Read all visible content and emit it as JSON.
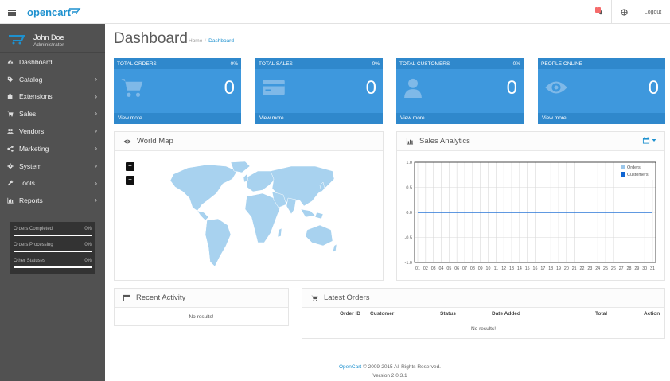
{
  "header": {
    "logo_text": "opencart",
    "notification_count": "1",
    "logout_label": "Logout"
  },
  "sidebar": {
    "profile": {
      "name": "John Doe",
      "role": "Administrator"
    },
    "items": [
      {
        "label": "Dashboard",
        "icon": "dashboard-icon",
        "has_children": false
      },
      {
        "label": "Catalog",
        "icon": "tag-icon",
        "has_children": true
      },
      {
        "label": "Extensions",
        "icon": "puzzle-icon",
        "has_children": true
      },
      {
        "label": "Sales",
        "icon": "cart-icon",
        "has_children": true
      },
      {
        "label": "Vendors",
        "icon": "users-icon",
        "has_children": true
      },
      {
        "label": "Marketing",
        "icon": "share-icon",
        "has_children": true
      },
      {
        "label": "System",
        "icon": "cog-icon",
        "has_children": true
      },
      {
        "label": "Tools",
        "icon": "wrench-icon",
        "has_children": true
      },
      {
        "label": "Reports",
        "icon": "bar-chart-icon",
        "has_children": true
      }
    ],
    "stats": [
      {
        "label": "Orders Completed",
        "value": "0%"
      },
      {
        "label": "Orders Processing",
        "value": "0%"
      },
      {
        "label": "Other Statuses",
        "value": "0%"
      }
    ]
  },
  "page": {
    "title": "Dashboard",
    "breadcrumb": [
      "Home",
      "Dashboard"
    ]
  },
  "tiles": [
    {
      "title": "TOTAL ORDERS",
      "percent": "0%",
      "value": "0",
      "link": "View more...",
      "icon": "cart-icon"
    },
    {
      "title": "TOTAL SALES",
      "percent": "0%",
      "value": "0",
      "link": "View more...",
      "icon": "credit-card-icon"
    },
    {
      "title": "TOTAL CUSTOMERS",
      "percent": "0%",
      "value": "0",
      "link": "View more...",
      "icon": "user-icon"
    },
    {
      "title": "PEOPLE ONLINE",
      "percent": "",
      "value": "0",
      "link": "View more...",
      "icon": "eye-icon"
    }
  ],
  "world_map": {
    "title": "World Map",
    "zoom_in": "+",
    "zoom_out": "−"
  },
  "sales_analytics": {
    "title": "Sales Analytics",
    "legend": [
      "Orders",
      "Customers"
    ]
  },
  "chart_data": {
    "type": "line",
    "title": "",
    "x": [
      "01",
      "02",
      "03",
      "04",
      "05",
      "06",
      "07",
      "08",
      "09",
      "10",
      "11",
      "12",
      "13",
      "14",
      "15",
      "16",
      "17",
      "18",
      "19",
      "20",
      "21",
      "22",
      "23",
      "24",
      "25",
      "26",
      "27",
      "28",
      "29",
      "30",
      "31"
    ],
    "series": [
      {
        "name": "Orders",
        "values": [
          0,
          0,
          0,
          0,
          0,
          0,
          0,
          0,
          0,
          0,
          0,
          0,
          0,
          0,
          0,
          0,
          0,
          0,
          0,
          0,
          0,
          0,
          0,
          0,
          0,
          0,
          0,
          0,
          0,
          0,
          0
        ],
        "color": "#9ac6ea"
      },
      {
        "name": "Customers",
        "values": [
          0,
          0,
          0,
          0,
          0,
          0,
          0,
          0,
          0,
          0,
          0,
          0,
          0,
          0,
          0,
          0,
          0,
          0,
          0,
          0,
          0,
          0,
          0,
          0,
          0,
          0,
          0,
          0,
          0,
          0,
          0
        ],
        "color": "#1065d2"
      }
    ],
    "yticks": [
      "1.0",
      "0.5",
      "0.0",
      "-0.5",
      "-1.0"
    ],
    "ylim": [
      -1,
      1
    ],
    "grid": true,
    "legend_position": "top-right"
  },
  "recent_activity": {
    "title": "Recent Activity",
    "empty": "No results!"
  },
  "latest_orders": {
    "title": "Latest Orders",
    "columns": [
      "Order ID",
      "Customer",
      "Status",
      "Date Added",
      "Total",
      "Action"
    ],
    "empty": "No results!"
  },
  "footer": {
    "brand": "OpenCart",
    "copyright": " © 2009-2015 All Rights Reserved.",
    "version": "Version 2.0.3.1"
  }
}
